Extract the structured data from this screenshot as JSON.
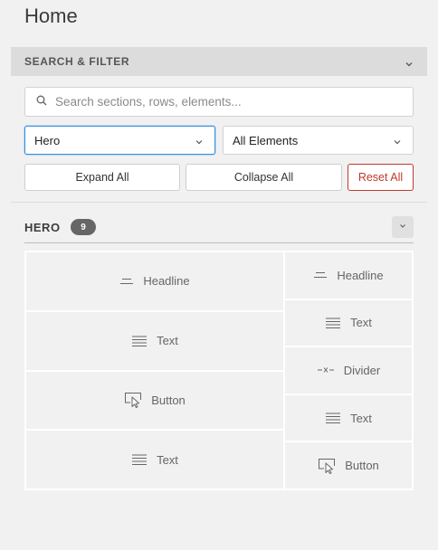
{
  "page": {
    "title": "Home"
  },
  "filter": {
    "header_label": "SEARCH & FILTER",
    "search_placeholder": "Search sections, rows, elements...",
    "section_select": "Hero",
    "element_select": "All Elements",
    "expand_label": "Expand All",
    "collapse_label": "Collapse All",
    "reset_label": "Reset All"
  },
  "section": {
    "title": "HERO",
    "count": "9",
    "left_column": [
      {
        "label": "Headline",
        "icon": "headline-icon"
      },
      {
        "label": "Text",
        "icon": "text-icon"
      },
      {
        "label": "Button",
        "icon": "button-icon"
      },
      {
        "label": "Text",
        "icon": "text-icon"
      }
    ],
    "right_column": [
      {
        "label": "Headline",
        "icon": "headline-icon"
      },
      {
        "label": "Text",
        "icon": "text-icon"
      },
      {
        "label": "Divider",
        "icon": "divider-icon"
      },
      {
        "label": "Text",
        "icon": "text-icon"
      },
      {
        "label": "Button",
        "icon": "button-icon"
      }
    ]
  },
  "colors": {
    "accent": "#3c8fd9",
    "danger": "#c0392b",
    "badge": "#666666",
    "header_bg": "#dcdcdc"
  }
}
